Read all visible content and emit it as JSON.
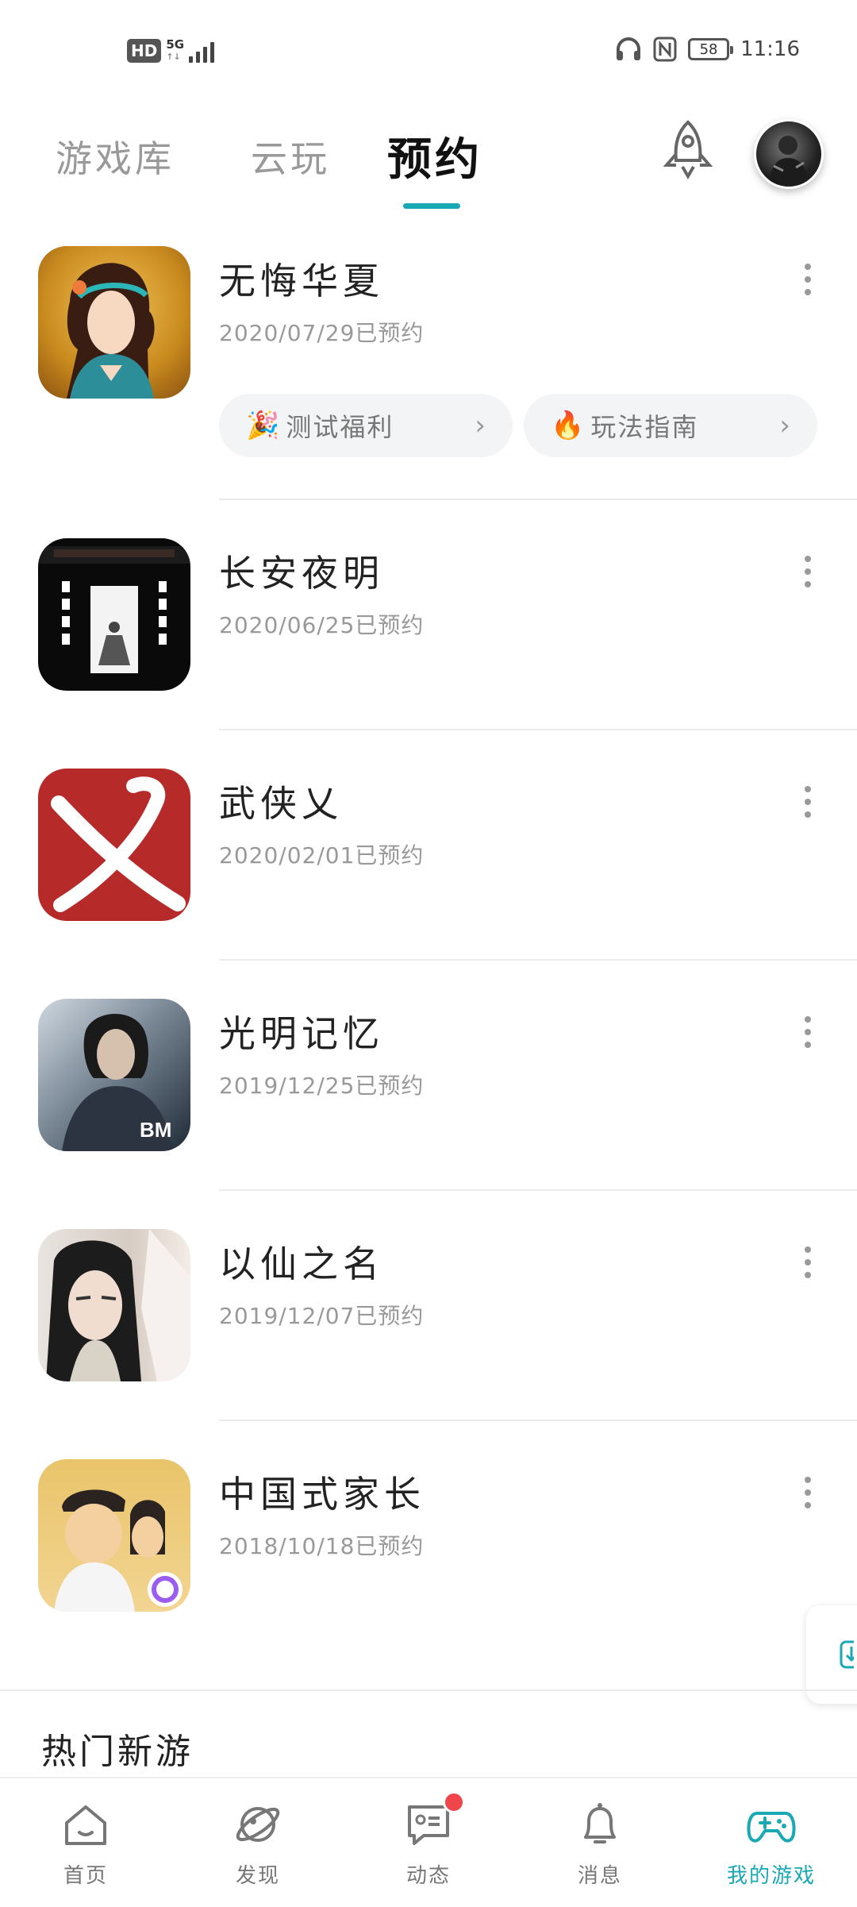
{
  "status_bar": {
    "hd": "HD",
    "network": "5G",
    "network_sub": "↑↓",
    "battery": "58",
    "time": "11:16"
  },
  "tabs": [
    {
      "label": "游戏库",
      "active": false
    },
    {
      "label": "云玩",
      "active": false
    },
    {
      "label": "预约",
      "active": true
    }
  ],
  "games": [
    {
      "title": "无悔华夏",
      "date": "2020/07/29已预约",
      "icon": "game-icon-wuhui-huaxia"
    },
    {
      "title": "长安夜明",
      "date": "2020/06/25已预约",
      "icon": "game-icon-changan-yeming"
    },
    {
      "title": "武侠乂",
      "date": "2020/02/01已预约",
      "icon": "game-icon-wuxia-yi"
    },
    {
      "title": "光明记忆",
      "date": "2019/12/25已预约",
      "icon": "game-icon-guangming-jiyi"
    },
    {
      "title": "以仙之名",
      "date": "2019/12/07已预约",
      "icon": "game-icon-yixian-zhiming"
    },
    {
      "title": "中国式家长",
      "date": "2018/10/18已预约",
      "icon": "game-icon-zhongguoshi-jiazhang"
    }
  ],
  "pills": [
    {
      "emoji": "🎉",
      "label": "测试福利"
    },
    {
      "emoji": "🔥",
      "label": "玩法指南"
    }
  ],
  "section": {
    "title": "热门新游"
  },
  "bottom_nav": [
    {
      "label": "首页",
      "icon": "home-icon",
      "active": false
    },
    {
      "label": "发现",
      "icon": "planet-icon",
      "active": false
    },
    {
      "label": "动态",
      "icon": "chat-icon",
      "active": false,
      "badge": true
    },
    {
      "label": "消息",
      "icon": "bell-icon",
      "active": false
    },
    {
      "label": "我的游戏",
      "icon": "gamepad-icon",
      "active": true
    }
  ],
  "colors": {
    "accent": "#1aa9b4",
    "badge": "#f0454b"
  }
}
